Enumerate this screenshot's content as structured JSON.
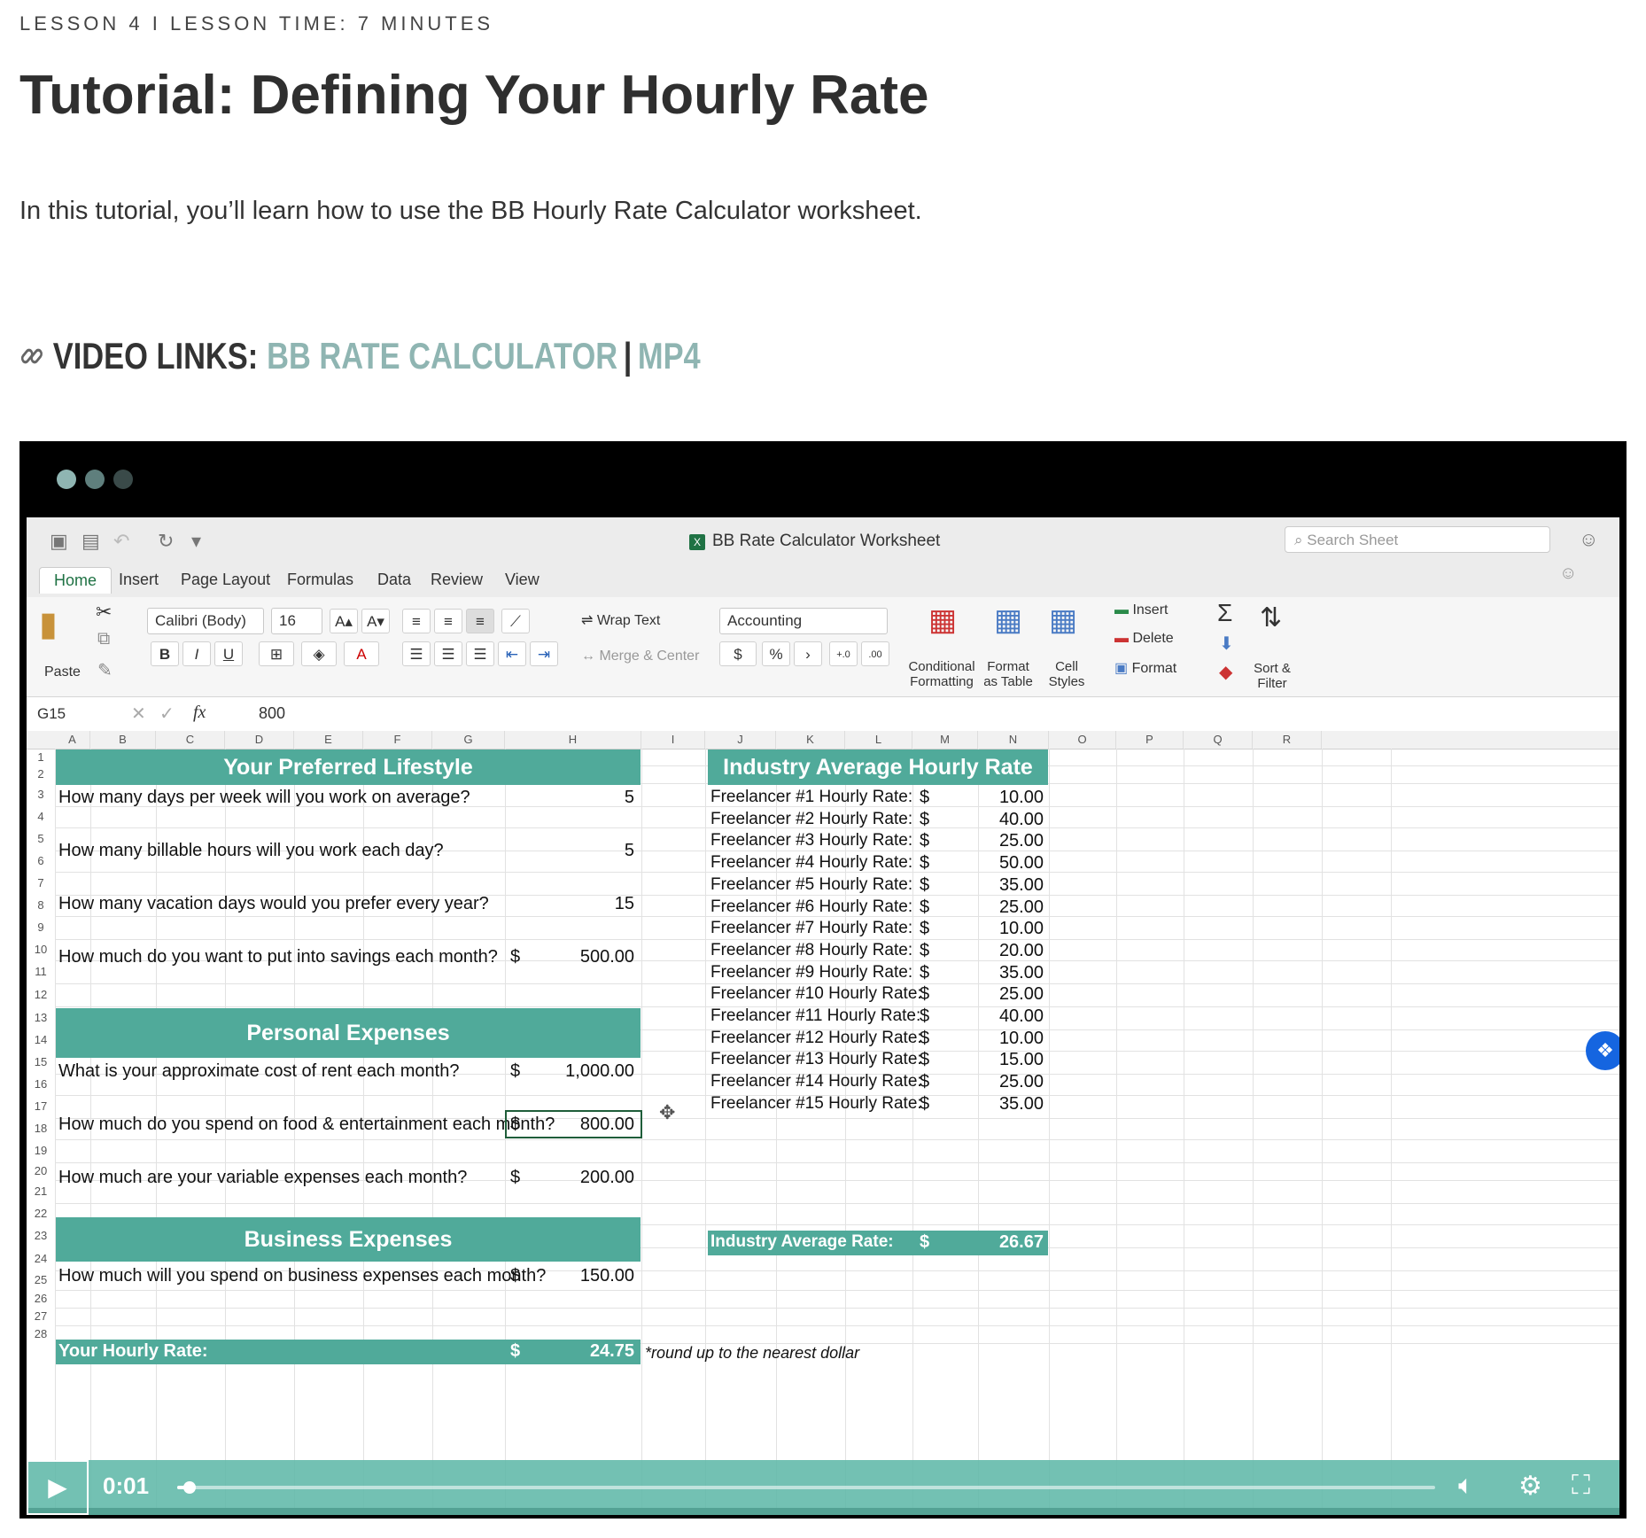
{
  "lesson": {
    "meta": "LESSON 4 I LESSON TIME: 7 MINUTES"
  },
  "title": "Tutorial: Defining Your Hourly Rate",
  "intro": "In this tutorial, you’ll learn how to use the BB Hourly Rate Calculator worksheet.",
  "video_links": {
    "label": "VIDEO LINKS:",
    "link1": "BB RATE CALCULATOR",
    "separator": "|",
    "link2": "MP4",
    "icon": "link-icon"
  },
  "player": {
    "dot_colors": [
      "#8fb5b2",
      "#5f7f7d",
      "#3a4a49"
    ],
    "time": "0:01",
    "progress": 0.01,
    "accent": "#60b8a8"
  },
  "excel": {
    "window_title": "BB Rate Calculator Worksheet",
    "search_placeholder": "Search Sheet",
    "tabs": [
      "Home",
      "Insert",
      "Page Layout",
      "Formulas",
      "Data",
      "Review",
      "View"
    ],
    "ribbon": {
      "paste": "Paste",
      "font_name": "Calibri (Body)",
      "font_size": "16",
      "bold": "B",
      "italic": "I",
      "underline": "U",
      "wrap_text": "Wrap Text",
      "merge_center": "Merge & Center",
      "number_format": "Accounting",
      "dollar": "$",
      "percent": "%",
      "comma": "›",
      "conditional_formatting": "Conditional Formatting",
      "format_as_table": "Format as Table",
      "cell_styles": "Cell Styles",
      "insert": "Insert",
      "delete": "Delete",
      "format": "Format",
      "sort_filter": "Sort & Filter"
    },
    "name_box": "G15",
    "fx": "fx",
    "formula_value": "800",
    "columns": [
      "A",
      "B",
      "C",
      "D",
      "E",
      "F",
      "G",
      "H",
      "I",
      "J",
      "K",
      "L",
      "M",
      "N",
      "O",
      "P",
      "Q",
      "R"
    ],
    "rows": [
      "1",
      "2",
      "3",
      "4",
      "5",
      "6",
      "7",
      "8",
      "9",
      "10",
      "11",
      "12",
      "13",
      "14",
      "15",
      "16",
      "17",
      "18",
      "19",
      "20",
      "21",
      "22",
      "23",
      "24",
      "25",
      "26",
      "27",
      "28"
    ],
    "lifestyle": {
      "header": "Your Preferred Lifestyle",
      "q_days": "How many days per week will you work on average?",
      "v_days": "5",
      "q_hours": "How many billable hours will you work each day?",
      "v_hours": "5",
      "q_vacation": "How many vacation days would you prefer every year?",
      "v_vacation": "15",
      "q_savings": "How much do you want to put into savings each month?",
      "v_savings": "500.00"
    },
    "personal": {
      "header": "Personal Expenses",
      "q_rent": "What is your approximate cost of rent each month?",
      "v_rent": "1,000.00",
      "q_food": "How much do you spend on food & entertainment each month?",
      "v_food": "800.00",
      "q_variable": "How much are your variable expenses each month?",
      "v_variable": "200.00"
    },
    "business": {
      "header": "Business Expenses",
      "q_business": "How much will you spend on business expenses each month?",
      "v_business": "150.00"
    },
    "result": {
      "label": "Your Hourly Rate:",
      "value": "24.75",
      "note": "*round up to the nearest dollar"
    },
    "currency": "$",
    "industry": {
      "header": "Industry Average Hourly Rate",
      "rates": [
        {
          "label": "Freelancer #1 Hourly Rate:",
          "value": "10.00"
        },
        {
          "label": "Freelancer #2 Hourly Rate:",
          "value": "40.00"
        },
        {
          "label": "Freelancer #3 Hourly Rate:",
          "value": "25.00"
        },
        {
          "label": "Freelancer #4 Hourly Rate:",
          "value": "50.00"
        },
        {
          "label": "Freelancer #5 Hourly Rate:",
          "value": "35.00"
        },
        {
          "label": "Freelancer #6 Hourly Rate:",
          "value": "25.00"
        },
        {
          "label": "Freelancer #7 Hourly Rate:",
          "value": "10.00"
        },
        {
          "label": "Freelancer #8 Hourly Rate:",
          "value": "20.00"
        },
        {
          "label": "Freelancer #9 Hourly Rate:",
          "value": "35.00"
        },
        {
          "label": "Freelancer #10 Hourly Rate:",
          "value": "25.00"
        },
        {
          "label": "Freelancer #11 Hourly Rate:",
          "value": "40.00"
        },
        {
          "label": "Freelancer #12 Hourly Rate:",
          "value": "10.00"
        },
        {
          "label": "Freelancer #13 Hourly Rate:",
          "value": "15.00"
        },
        {
          "label": "Freelancer #14 Hourly Rate:",
          "value": "25.00"
        },
        {
          "label": "Freelancer #15 Hourly Rate:",
          "value": "35.00"
        }
      ],
      "avg_label": "Industry Average Rate:",
      "avg_value": "26.67"
    }
  }
}
